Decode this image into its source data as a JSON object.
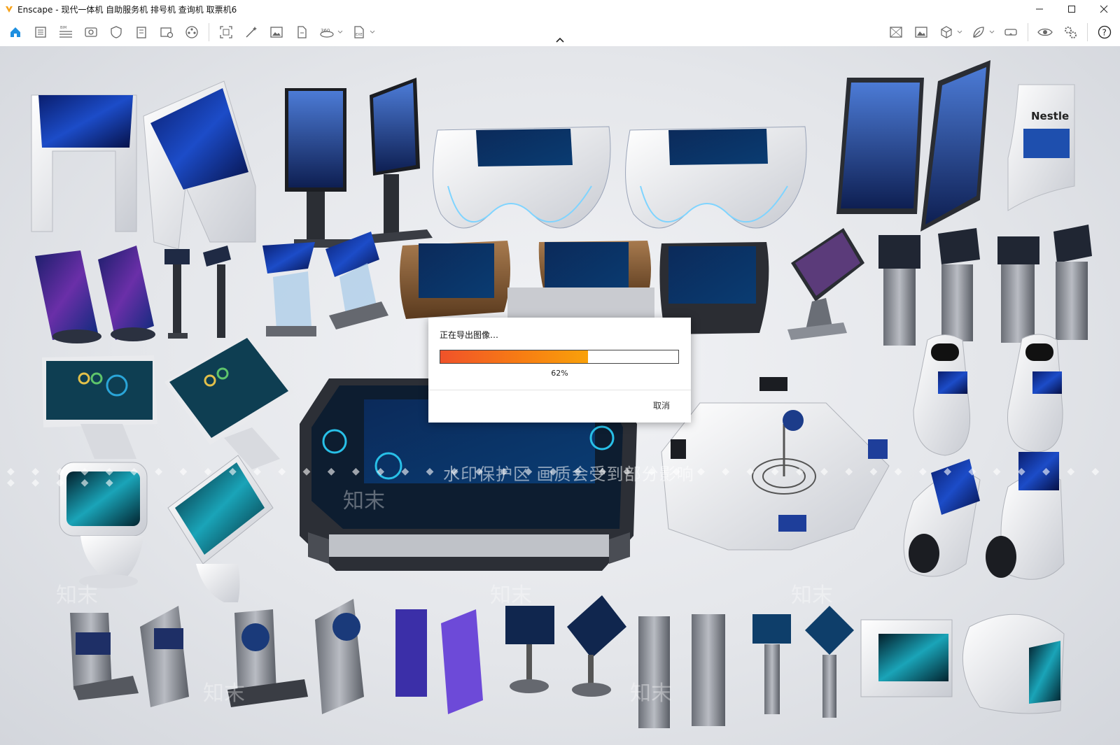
{
  "window": {
    "title": "Enscape - 现代一体机 自助服务机 排号机 查询机 取票机6",
    "app_icon": "enscape-logo-icon",
    "accent_color": "#f7a21b",
    "controls": [
      "minimize-icon",
      "maximize-icon",
      "close-icon"
    ]
  },
  "toolbar": {
    "left_icons": [
      "home-icon",
      "document-icon",
      "bim-icon",
      "view-icon",
      "shield-icon",
      "building-icon",
      "photo-settings-icon",
      "material-icon",
      "capture-frame-icon",
      "magic-wand-icon",
      "screenshot-icon",
      "export-file-icon",
      "panorama-360-icon",
      "exe-export-icon"
    ],
    "right_icons": [
      "image-export-icon",
      "image-icon",
      "cube-icon",
      "leaf-icon",
      "vr-headset-icon",
      "eye-icon",
      "settings-gear-icon",
      "help-icon"
    ],
    "bim_label": "BIM",
    "exe_label": "EXE",
    "home_color": "#1e8fe0"
  },
  "viewport": {
    "watermark_text": "水印保护区  画质会受到部分影响",
    "watermark_logo": "知末",
    "scene": "kiosk-products-render"
  },
  "dialog": {
    "message": "正在导出图像…",
    "progress_percent": 62,
    "progress_label": "62%",
    "cancel_label": "取消"
  }
}
